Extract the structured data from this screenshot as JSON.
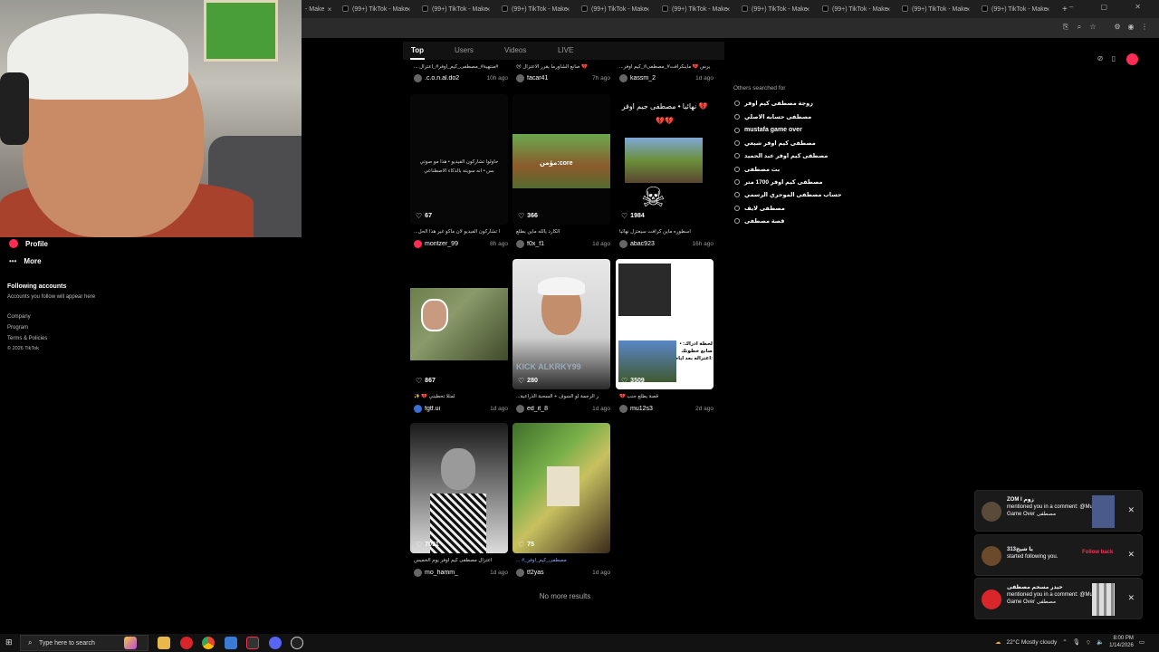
{
  "browser": {
    "tabs": [
      "- Make",
      "(99+) TikTok - Make",
      "(99+) TikTok - Make",
      "(99+) TikTok - Make",
      "(99+) TikTok - Make",
      "(99+) TikTok - Make",
      "(99+) TikTok - Make",
      "(99+) TikTok - Make",
      "(99+) TikTok - Make",
      "(99+) TikTok - Make"
    ],
    "new_tab": "+",
    "window_controls": "– ▢ ✕"
  },
  "sidebar": {
    "profile": "Profile",
    "more": "More",
    "following_heading": "Following accounts",
    "following_hint": "Accounts you follow will appear here",
    "footer": [
      "Company",
      "Program",
      "Terms & Policies",
      "© 2026 TikTok"
    ]
  },
  "search_tabs": [
    "Top",
    "Users",
    "Videos",
    "LIVE"
  ],
  "videos": [
    {
      "caption": "... منتهية#_مصطفى_كيم_اوفر#_اعتزال#",
      "user": ".c.o.n.al.do2",
      "ago": "10h ago"
    },
    {
      "caption": "😢 صانع الشاورما يقرر الاعتزال 💔",
      "user": "facar41",
      "ago": "7h ago"
    },
    {
      "caption": "...يرس 💔 ماينكرافت#_مصطفى#_كيم اوفر",
      "user": "kassm_2",
      "ago": "1d ago"
    },
    {
      "overlay": "حاولوا تشاركون الفيديو • هذا مو صوتي بس • انه سويته بالذكاء الاصطناعي",
      "likes": "67",
      "caption": "...ا تشاركون الفيديو لأن ماكو غير هذا الحل",
      "user": "montzer_99",
      "ago": "8h ago"
    },
    {
      "overlay": "مؤمن:core",
      "likes": "366",
      "caption": "الكارد يالله ماين يطلع",
      "user": "f0x_f1",
      "ago": "1d ago"
    },
    {
      "overlay": "نهائيا • مصطفى جيم اوفر 💔💔💔",
      "likes": "1984",
      "caption": "اسطوره ماين كرافت سيعتزل نهائيا",
      "user": "abac923",
      "ago": "16h ago"
    },
    {
      "likes": "867",
      "caption": "✨ 💔 لمثلا تحطيني",
      "user": "fgtf.ui",
      "ago": "1d ago"
    },
    {
      "overlay": "KICK ALKRKY99",
      "likes": "280",
      "caption": "...ر الرجمة لو السوف + السحبة الذراعية",
      "user": "ed_it_8",
      "ago": "1d ago"
    },
    {
      "overlay": "لحظة ادراك: • صانع خطوتك اعتزاله بعد ايام:",
      "likes": "3509",
      "caption": "💔 قصة يطلع جنب",
      "user": "mu12s3",
      "ago": "2d ago"
    },
    {
      "likes": "7051",
      "caption": "اعتزال مصطفى كيم اوفر يوم الخميس",
      "user": "mo_hamm_",
      "ago": "1d ago"
    },
    {
      "likes": "75",
      "caption": "... #_مصطفى_كيم_اوفر",
      "user": "tf2yas",
      "ago": "1d ago"
    }
  ],
  "no_more": "No more results",
  "others": {
    "title": "Others searched for",
    "items": [
      "زوجة مصطفى كيم اوفر",
      "مصطفى حسابه الاصلي",
      "mustafa game over",
      "مصطفى كيم اوفر شيعي",
      "مصطفى كيم اوفر عبد الحميد",
      "بث مصطفى",
      "مصطفى كيم اوفر 1700 متر",
      "حساب مصطفى الموحري الرسمي",
      "مصطفى لايف",
      "قصة مصطفى"
    ]
  },
  "notifications": [
    {
      "title": "ZOM l زوم",
      "body": "mentioned you in a comment: @Mustafa Game Over مصطفى",
      "action": ""
    },
    {
      "title": "313يا شيخ",
      "body": "started following you.",
      "action": "Follow back"
    },
    {
      "title": "حيدر مسحم مصطفى",
      "body": "mentioned you in a comment: @Mustafa Game Over مصطفى",
      "action": ""
    }
  ],
  "taskbar": {
    "search_placeholder": "Type here to search",
    "weather": "22°C  Mostly cloudy",
    "time": "8:00 PM",
    "date": "1/14/2026"
  },
  "colors": {
    "accent": "#fe2c55",
    "background": "#000000"
  }
}
